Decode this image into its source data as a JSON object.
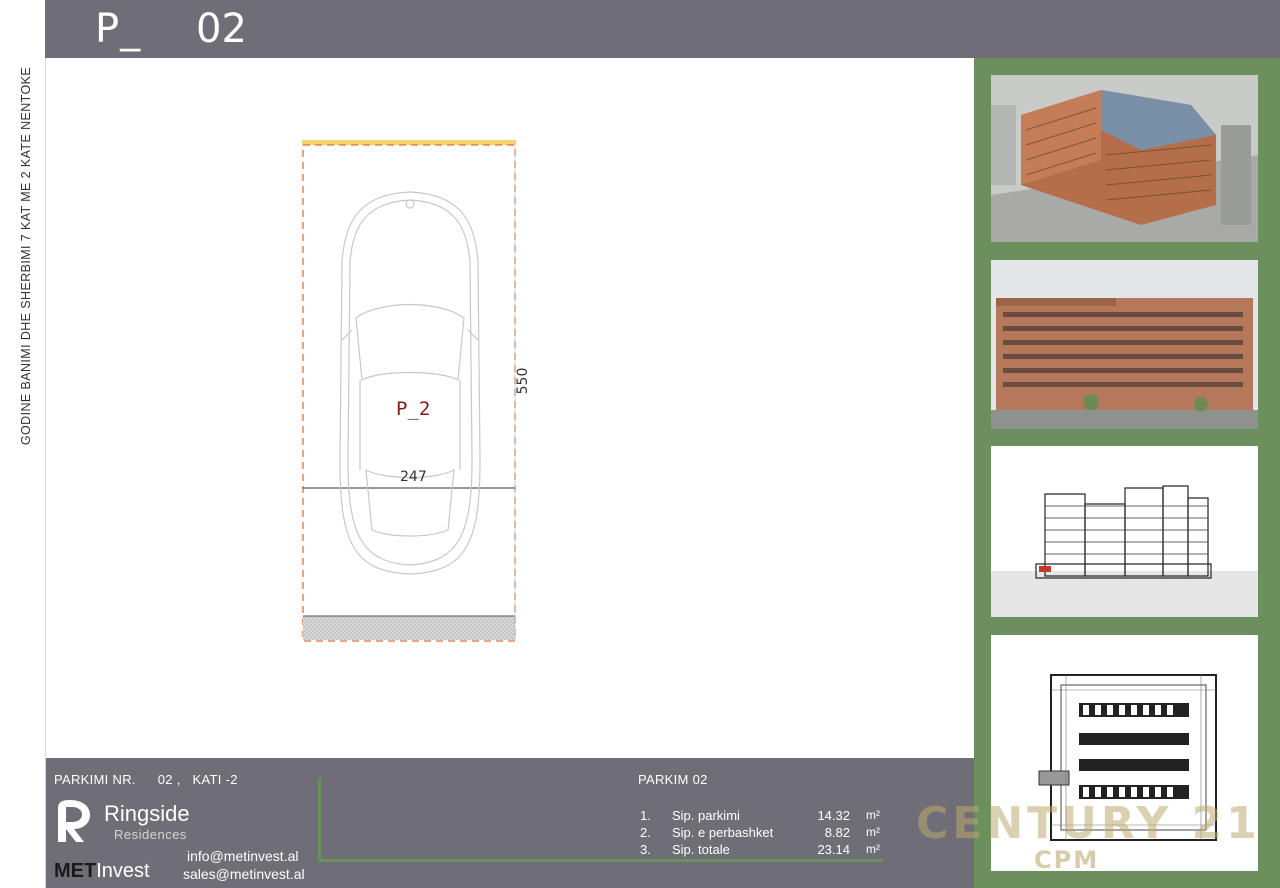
{
  "sidebar": {
    "building_title": "GODINE BANIMI DHE SHERBIMI 7 KAT ME 2 KATE NENTOKE"
  },
  "header": {
    "code": "P_",
    "number": "02"
  },
  "plan": {
    "spot_label": "P_2",
    "width_dimension": "247",
    "length_dimension": "550"
  },
  "footer": {
    "parking_label": "PARKIMI NR.",
    "parking_number": "02 ,",
    "floor_label": "KATI -2",
    "brand_name": "Ringside",
    "brand_sub": "Residences",
    "developer_bold": "MET",
    "developer_rest": "Invest",
    "email_info": "info@metinvest.al",
    "email_sales": "sales@metinvest.al",
    "area_title": "PARKIM 02",
    "area_rows": [
      {
        "idx": "1.",
        "label": "Sip. parkimi",
        "value": "14.32",
        "unit": "m²"
      },
      {
        "idx": "2.",
        "label": "Sip. e perbashket",
        "value": "8.82",
        "unit": "m²"
      },
      {
        "idx": "3.",
        "label": "Sip. totale",
        "value": "23.14",
        "unit": "m²"
      }
    ]
  },
  "watermark": {
    "main": "CENTURY 21",
    "sub": "CPM"
  },
  "colors": {
    "header_gray": "#6f6e76",
    "panel_green": "#6c8f5e",
    "spot_outline": "#e0703a",
    "spot_label": "#8a1a1a"
  }
}
